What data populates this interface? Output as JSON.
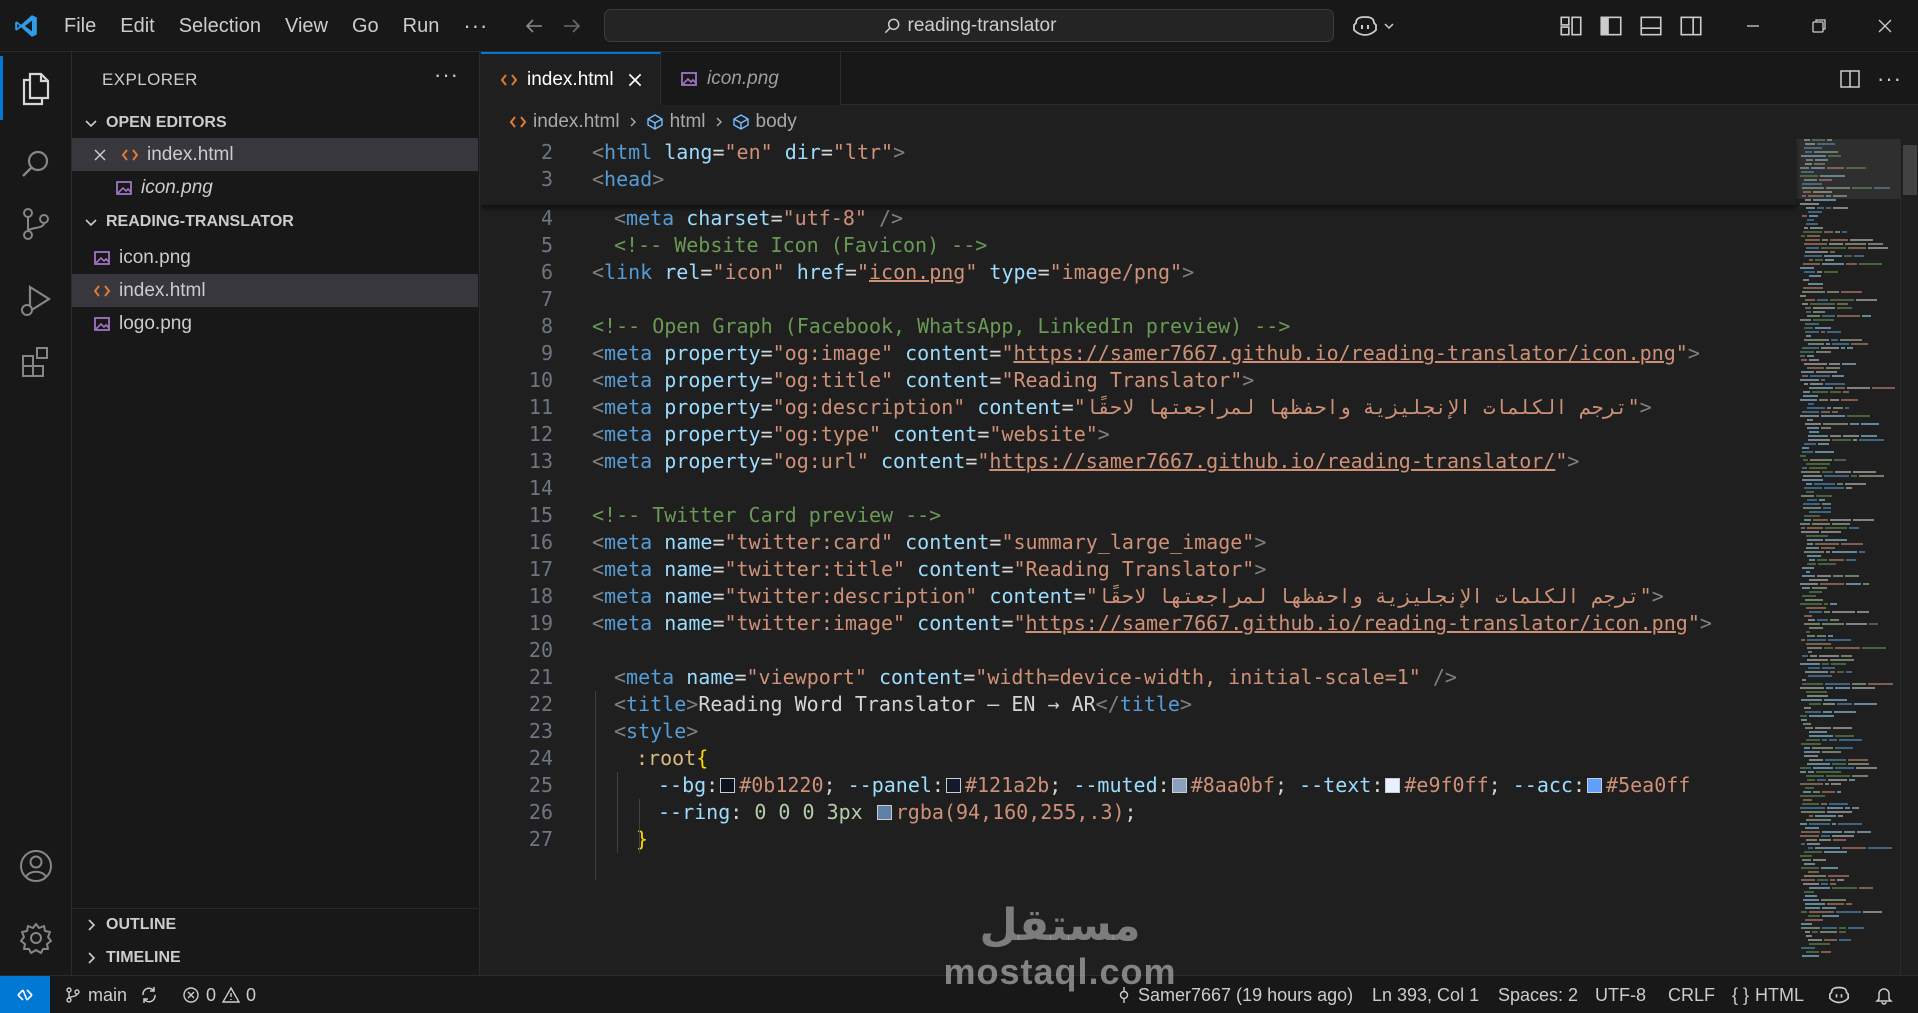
{
  "titlebar": {
    "menu": [
      "File",
      "Edit",
      "Selection",
      "View",
      "Go",
      "Run"
    ],
    "more": "···",
    "search_text": "reading-translator"
  },
  "explorer": {
    "title": "EXPLORER",
    "more": "···",
    "open_editors_label": "OPEN EDITORS",
    "open_editors": [
      {
        "name": "index.html",
        "icon": "html-file-icon",
        "active": true
      },
      {
        "name": "icon.png",
        "icon": "image-file-icon",
        "italic": true
      }
    ],
    "folder_label": "READING-TRANSLATOR",
    "files": [
      {
        "name": "icon.png",
        "icon": "image-file-icon"
      },
      {
        "name": "index.html",
        "icon": "html-file-icon",
        "selected": true
      },
      {
        "name": "logo.png",
        "icon": "image-file-icon"
      }
    ],
    "outline_label": "OUTLINE",
    "timeline_label": "TIMELINE"
  },
  "tabs": [
    {
      "label": "index.html",
      "active": true
    },
    {
      "label": "icon.png",
      "active": false
    }
  ],
  "breadcrumb": [
    "index.html",
    "html",
    "body"
  ],
  "code_lines": [
    {
      "n": "2",
      "indent": 0,
      "tokens": [
        [
          "br",
          "<"
        ],
        [
          "tag",
          "html"
        ],
        [
          "text",
          " "
        ],
        [
          "attr",
          "lang"
        ],
        [
          "text",
          "="
        ],
        [
          "str",
          "\"en\""
        ],
        [
          "text",
          " "
        ],
        [
          "attr",
          "dir"
        ],
        [
          "text",
          "="
        ],
        [
          "str",
          "\"ltr\""
        ],
        [
          "br",
          ">"
        ]
      ]
    },
    {
      "n": "3",
      "indent": 0,
      "tokens": [
        [
          "br",
          "<"
        ],
        [
          "tag",
          "head"
        ],
        [
          "br",
          ">"
        ]
      ]
    },
    {
      "n": "4",
      "indent": 1,
      "tokens": [
        [
          "br",
          "<"
        ],
        [
          "tag",
          "meta"
        ],
        [
          "text",
          " "
        ],
        [
          "attr",
          "charset"
        ],
        [
          "text",
          "="
        ],
        [
          "str",
          "\"utf-8\""
        ],
        [
          "text",
          " "
        ],
        [
          "br",
          "/>"
        ]
      ]
    },
    {
      "n": "5",
      "indent": 1,
      "tokens": [
        [
          "com",
          "<!-- Website Icon (Favicon) -->"
        ]
      ]
    },
    {
      "n": "6",
      "indent": 0,
      "tokens": [
        [
          "br",
          "<"
        ],
        [
          "tag",
          "link"
        ],
        [
          "text",
          " "
        ],
        [
          "attr",
          "rel"
        ],
        [
          "text",
          "="
        ],
        [
          "str",
          "\"icon\""
        ],
        [
          "text",
          " "
        ],
        [
          "attr",
          "href"
        ],
        [
          "text",
          "="
        ],
        [
          "str",
          "\""
        ],
        [
          "url",
          "icon.png"
        ],
        [
          "str",
          "\""
        ],
        [
          "text",
          " "
        ],
        [
          "attr",
          "type"
        ],
        [
          "text",
          "="
        ],
        [
          "str",
          "\"image/png\""
        ],
        [
          "br",
          ">"
        ]
      ]
    },
    {
      "n": "7",
      "indent": 0,
      "tokens": []
    },
    {
      "n": "8",
      "indent": 0,
      "tokens": [
        [
          "com",
          "<!-- Open Graph (Facebook, WhatsApp, LinkedIn preview) -->"
        ]
      ]
    },
    {
      "n": "9",
      "indent": 0,
      "tokens": [
        [
          "br",
          "<"
        ],
        [
          "tag",
          "meta"
        ],
        [
          "text",
          " "
        ],
        [
          "attr",
          "property"
        ],
        [
          "text",
          "="
        ],
        [
          "str",
          "\"og:image\""
        ],
        [
          "text",
          " "
        ],
        [
          "attr",
          "content"
        ],
        [
          "text",
          "="
        ],
        [
          "str",
          "\""
        ],
        [
          "url",
          "https://samer7667.github.io/reading-translator/icon.png"
        ],
        [
          "str",
          "\""
        ],
        [
          "br",
          ">"
        ]
      ]
    },
    {
      "n": "10",
      "indent": 0,
      "tokens": [
        [
          "br",
          "<"
        ],
        [
          "tag",
          "meta"
        ],
        [
          "text",
          " "
        ],
        [
          "attr",
          "property"
        ],
        [
          "text",
          "="
        ],
        [
          "str",
          "\"og:title\""
        ],
        [
          "text",
          " "
        ],
        [
          "attr",
          "content"
        ],
        [
          "text",
          "="
        ],
        [
          "str",
          "\"Reading Translator\""
        ],
        [
          "br",
          ">"
        ]
      ]
    },
    {
      "n": "11",
      "indent": 0,
      "tokens": [
        [
          "br",
          "<"
        ],
        [
          "tag",
          "meta"
        ],
        [
          "text",
          " "
        ],
        [
          "attr",
          "property"
        ],
        [
          "text",
          "="
        ],
        [
          "str",
          "\"og:description\""
        ],
        [
          "text",
          " "
        ],
        [
          "attr",
          "content"
        ],
        [
          "text",
          "="
        ],
        [
          "str",
          "\"ترجم الكلمات الإنجليزية واحفظها لمراجعتها لاحقًا\""
        ],
        [
          "br",
          ">"
        ]
      ]
    },
    {
      "n": "12",
      "indent": 0,
      "tokens": [
        [
          "br",
          "<"
        ],
        [
          "tag",
          "meta"
        ],
        [
          "text",
          " "
        ],
        [
          "attr",
          "property"
        ],
        [
          "text",
          "="
        ],
        [
          "str",
          "\"og:type\""
        ],
        [
          "text",
          " "
        ],
        [
          "attr",
          "content"
        ],
        [
          "text",
          "="
        ],
        [
          "str",
          "\"website\""
        ],
        [
          "br",
          ">"
        ]
      ]
    },
    {
      "n": "13",
      "indent": 0,
      "tokens": [
        [
          "br",
          "<"
        ],
        [
          "tag",
          "meta"
        ],
        [
          "text",
          " "
        ],
        [
          "attr",
          "property"
        ],
        [
          "text",
          "="
        ],
        [
          "str",
          "\"og:url\""
        ],
        [
          "text",
          " "
        ],
        [
          "attr",
          "content"
        ],
        [
          "text",
          "="
        ],
        [
          "str",
          "\""
        ],
        [
          "url",
          "https://samer7667.github.io/reading-translator/"
        ],
        [
          "str",
          "\""
        ],
        [
          "br",
          ">"
        ]
      ]
    },
    {
      "n": "14",
      "indent": 0,
      "tokens": []
    },
    {
      "n": "15",
      "indent": 0,
      "tokens": [
        [
          "com",
          "<!-- Twitter Card preview -->"
        ]
      ]
    },
    {
      "n": "16",
      "indent": 0,
      "tokens": [
        [
          "br",
          "<"
        ],
        [
          "tag",
          "meta"
        ],
        [
          "text",
          " "
        ],
        [
          "attr",
          "name"
        ],
        [
          "text",
          "="
        ],
        [
          "str",
          "\"twitter:card\""
        ],
        [
          "text",
          " "
        ],
        [
          "attr",
          "content"
        ],
        [
          "text",
          "="
        ],
        [
          "str",
          "\"summary_large_image\""
        ],
        [
          "br",
          ">"
        ]
      ]
    },
    {
      "n": "17",
      "indent": 0,
      "tokens": [
        [
          "br",
          "<"
        ],
        [
          "tag",
          "meta"
        ],
        [
          "text",
          " "
        ],
        [
          "attr",
          "name"
        ],
        [
          "text",
          "="
        ],
        [
          "str",
          "\"twitter:title\""
        ],
        [
          "text",
          " "
        ],
        [
          "attr",
          "content"
        ],
        [
          "text",
          "="
        ],
        [
          "str",
          "\"Reading Translator\""
        ],
        [
          "br",
          ">"
        ]
      ]
    },
    {
      "n": "18",
      "indent": 0,
      "tokens": [
        [
          "br",
          "<"
        ],
        [
          "tag",
          "meta"
        ],
        [
          "text",
          " "
        ],
        [
          "attr",
          "name"
        ],
        [
          "text",
          "="
        ],
        [
          "str",
          "\"twitter:description\""
        ],
        [
          "text",
          " "
        ],
        [
          "attr",
          "content"
        ],
        [
          "text",
          "="
        ],
        [
          "str",
          "\"ترجم الكلمات الإنجليزية واحفظها لمراجعتها لاحقًا\""
        ],
        [
          "br",
          ">"
        ]
      ]
    },
    {
      "n": "19",
      "indent": 0,
      "tokens": [
        [
          "br",
          "<"
        ],
        [
          "tag",
          "meta"
        ],
        [
          "text",
          " "
        ],
        [
          "attr",
          "name"
        ],
        [
          "text",
          "="
        ],
        [
          "str",
          "\"twitter:image\""
        ],
        [
          "text",
          " "
        ],
        [
          "attr",
          "content"
        ],
        [
          "text",
          "="
        ],
        [
          "str",
          "\""
        ],
        [
          "url",
          "https://samer7667.github.io/reading-translator/icon.png"
        ],
        [
          "str",
          "\""
        ],
        [
          "br",
          ">"
        ]
      ]
    },
    {
      "n": "20",
      "indent": 0,
      "tokens": []
    },
    {
      "n": "21",
      "indent": 1,
      "tokens": [
        [
          "br",
          "<"
        ],
        [
          "tag",
          "meta"
        ],
        [
          "text",
          " "
        ],
        [
          "attr",
          "name"
        ],
        [
          "text",
          "="
        ],
        [
          "str",
          "\"viewport\""
        ],
        [
          "text",
          " "
        ],
        [
          "attr",
          "content"
        ],
        [
          "text",
          "="
        ],
        [
          "str",
          "\"width=device-width, initial-scale=1\""
        ],
        [
          "text",
          " "
        ],
        [
          "br",
          "/>"
        ]
      ]
    },
    {
      "n": "22",
      "indent": 1,
      "tokens": [
        [
          "br",
          "<"
        ],
        [
          "tag",
          "title"
        ],
        [
          "br",
          ">"
        ],
        [
          "text",
          "Reading Word Translator — EN → AR"
        ],
        [
          "br",
          "</"
        ],
        [
          "tag",
          "title"
        ],
        [
          "br",
          ">"
        ]
      ]
    },
    {
      "n": "23",
      "indent": 1,
      "tokens": [
        [
          "br",
          "<"
        ],
        [
          "tag",
          "style"
        ],
        [
          "br",
          ">"
        ]
      ]
    },
    {
      "n": "24",
      "indent": 2,
      "tokens": [
        [
          "sel",
          ":root"
        ],
        [
          "brace",
          "{"
        ]
      ]
    },
    {
      "n": "25",
      "indent": 3,
      "tokens": [
        [
          "prop",
          "--bg"
        ],
        [
          "text",
          ":"
        ],
        [
          "swatch",
          "#0b1220"
        ],
        [
          "str",
          "#0b1220"
        ],
        [
          "text",
          "; "
        ],
        [
          "prop",
          "--panel"
        ],
        [
          "text",
          ":"
        ],
        [
          "swatch",
          "#121a2b"
        ],
        [
          "str",
          "#121a2b"
        ],
        [
          "text",
          "; "
        ],
        [
          "prop",
          "--muted"
        ],
        [
          "text",
          ":"
        ],
        [
          "swatch",
          "#8aa0bf"
        ],
        [
          "str",
          "#8aa0bf"
        ],
        [
          "text",
          "; "
        ],
        [
          "prop",
          "--text"
        ],
        [
          "text",
          ":"
        ],
        [
          "swatch",
          "#e9f0ff"
        ],
        [
          "str",
          "#e9f0ff"
        ],
        [
          "text",
          "; "
        ],
        [
          "prop",
          "--acc"
        ],
        [
          "text",
          ":"
        ],
        [
          "swatch",
          "#5ea0ff"
        ],
        [
          "str",
          "#5ea0ff"
        ]
      ]
    },
    {
      "n": "26",
      "indent": 3,
      "tokens": [
        [
          "prop",
          "--ring"
        ],
        [
          "text",
          ": "
        ],
        [
          "num",
          "0 0 0 3px"
        ],
        [
          "text",
          " "
        ],
        [
          "swatch",
          "#5e7fa8"
        ],
        [
          "str",
          "rgba(94,160,255,.3)"
        ],
        [
          "text",
          ";"
        ]
      ]
    },
    {
      "n": "27",
      "indent": 2,
      "tokens": [
        [
          "brace",
          "}"
        ]
      ]
    }
  ],
  "statusbar": {
    "branch": "main",
    "errors": "0",
    "warnings": "0",
    "blame": "Samer7667 (19 hours ago)",
    "position": "Ln 393, Col 1",
    "spaces": "Spaces: 2",
    "encoding": "UTF-8",
    "eol": "CRLF",
    "language_braces": "{ }",
    "language": "HTML"
  },
  "watermark": {
    "arabic": "مستقل",
    "latin": "mostaql.com"
  },
  "colors": {
    "accent": "#0078d4",
    "editor_bg": "#1f1f1f",
    "sidebar_bg": "#181818",
    "selection": "#37373d"
  }
}
